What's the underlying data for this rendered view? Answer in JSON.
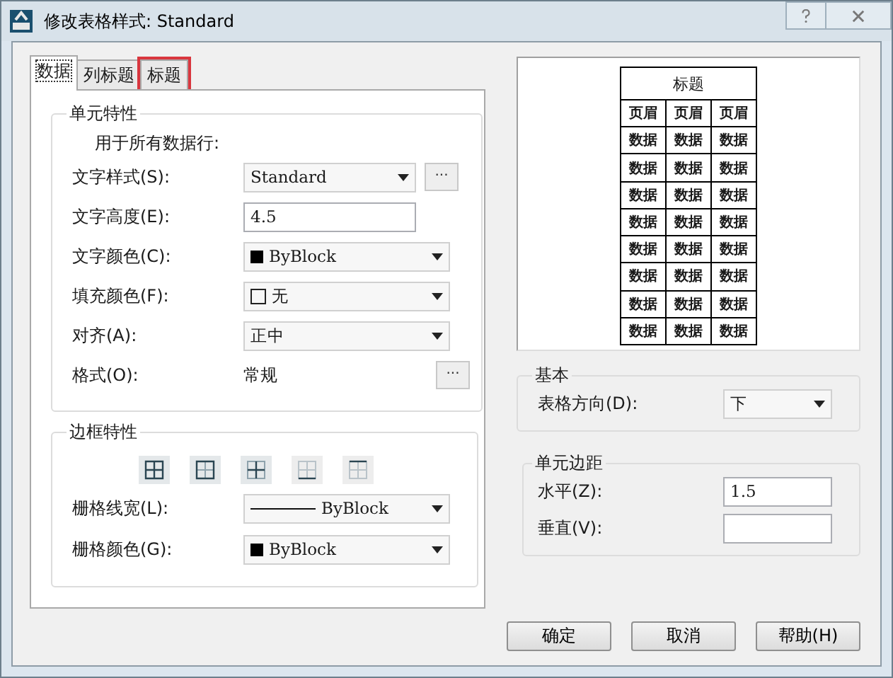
{
  "window": {
    "title": "修改表格样式: Standard"
  },
  "tabs": [
    {
      "label": "数据",
      "selected": true,
      "highlighted": false
    },
    {
      "label": "列标题",
      "selected": false,
      "highlighted": false
    },
    {
      "label": "标题",
      "selected": false,
      "highlighted": true
    }
  ],
  "cell_properties": {
    "title": "单元特性",
    "note": "用于所有数据行:",
    "rows": [
      {
        "label": "文字样式(S):",
        "kind": "dropdown",
        "value": "Standard",
        "more": "..."
      },
      {
        "label": "文字高度(E):",
        "kind": "input",
        "value": "4.5"
      },
      {
        "label": "文字颜色(C):",
        "kind": "swatch",
        "value": "ByBlock"
      },
      {
        "label": "填充颜色(F):",
        "kind": "noswatch",
        "value": "无"
      },
      {
        "label": "对齐(A):",
        "kind": "dropdown",
        "value": "正中"
      },
      {
        "label": "格式(O):",
        "kind": "static",
        "value": "常规",
        "more": "..."
      }
    ]
  },
  "border_properties": {
    "title": "边框特性",
    "rows": [
      {
        "label": "栅格线宽(L):",
        "kind": "linewidth",
        "value": "ByBlock"
      },
      {
        "label": "栅格颜色(G):",
        "kind": "swatch",
        "value": "ByBlock"
      }
    ]
  },
  "preview": {
    "title": "标题",
    "header": [
      "页眉",
      "页眉",
      "页眉"
    ],
    "rows": [
      [
        "数据",
        "数据",
        "数据"
      ],
      [
        "数据",
        "数据",
        "数据"
      ],
      [
        "数据",
        "数据",
        "数据"
      ],
      [
        "数据",
        "数据",
        "数据"
      ],
      [
        "数据",
        "数据",
        "数据"
      ],
      [
        "数据",
        "数据",
        "数据"
      ],
      [
        "数据",
        "数据",
        "数据"
      ],
      [
        "数据",
        "数据",
        "数据"
      ]
    ]
  },
  "basic": {
    "title": "基本",
    "rows": [
      {
        "label": "表格方向(D):",
        "kind": "dropdown",
        "value": "下"
      }
    ]
  },
  "margins": {
    "title": "单元边距",
    "rows": [
      {
        "label": "水平(Z):",
        "kind": "input",
        "value": "1.5"
      },
      {
        "label": "垂直(V):",
        "kind": "input"
      }
    ]
  },
  "buttons": [
    "确定",
    "取消",
    "帮助(H)"
  ]
}
